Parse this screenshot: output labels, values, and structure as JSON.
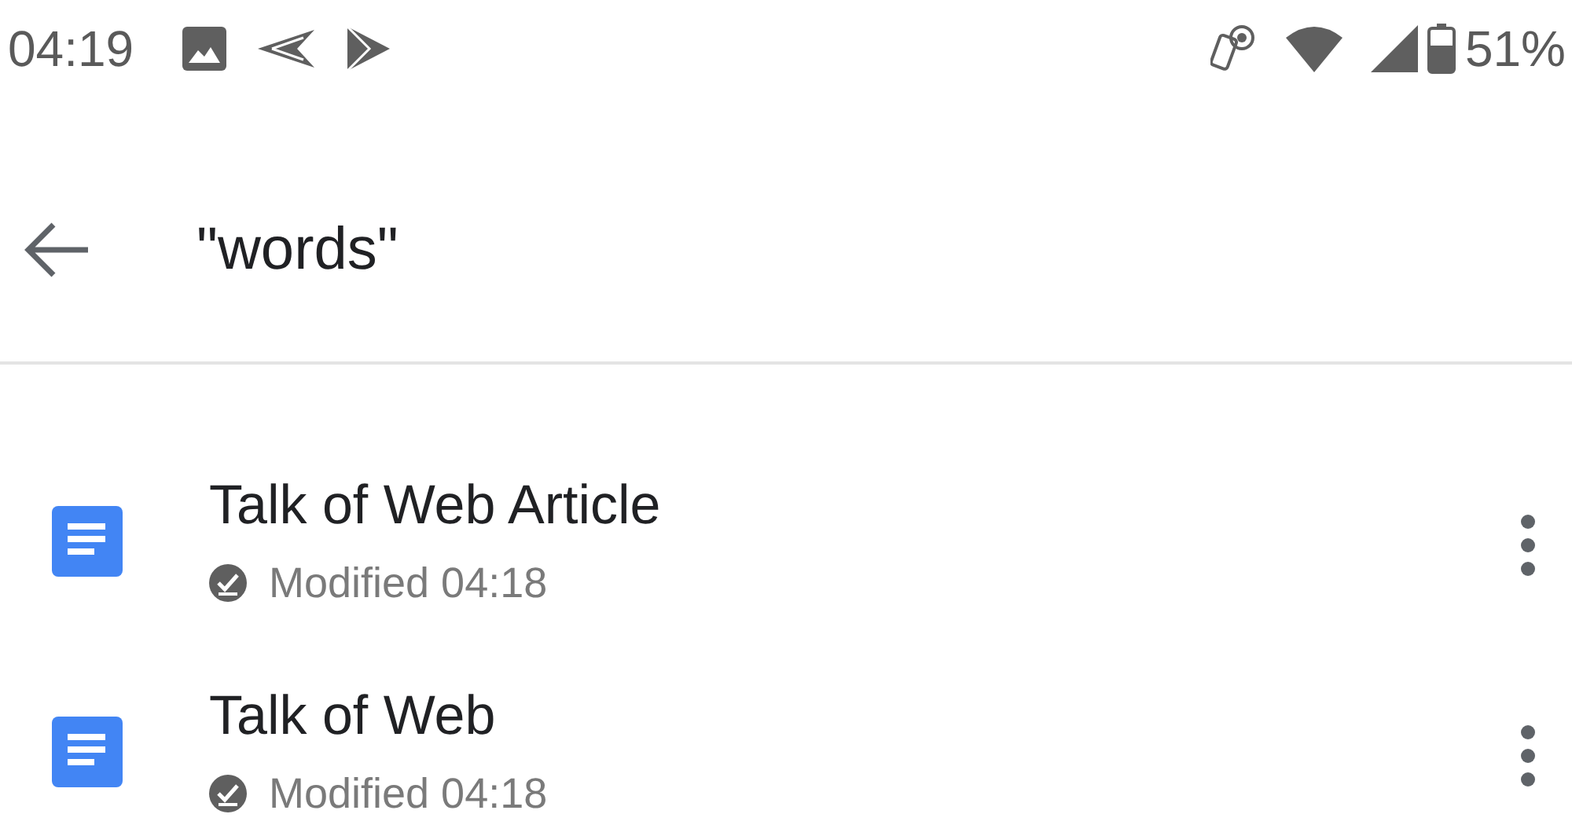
{
  "status_bar": {
    "time": "04:19",
    "battery": "51%"
  },
  "toolbar": {
    "query": "\"words\""
  },
  "results": [
    {
      "title": "Talk of Web Article",
      "subtitle": "Modified 04:18"
    },
    {
      "title": "Talk of Web",
      "subtitle": "Modified 04:18"
    }
  ]
}
